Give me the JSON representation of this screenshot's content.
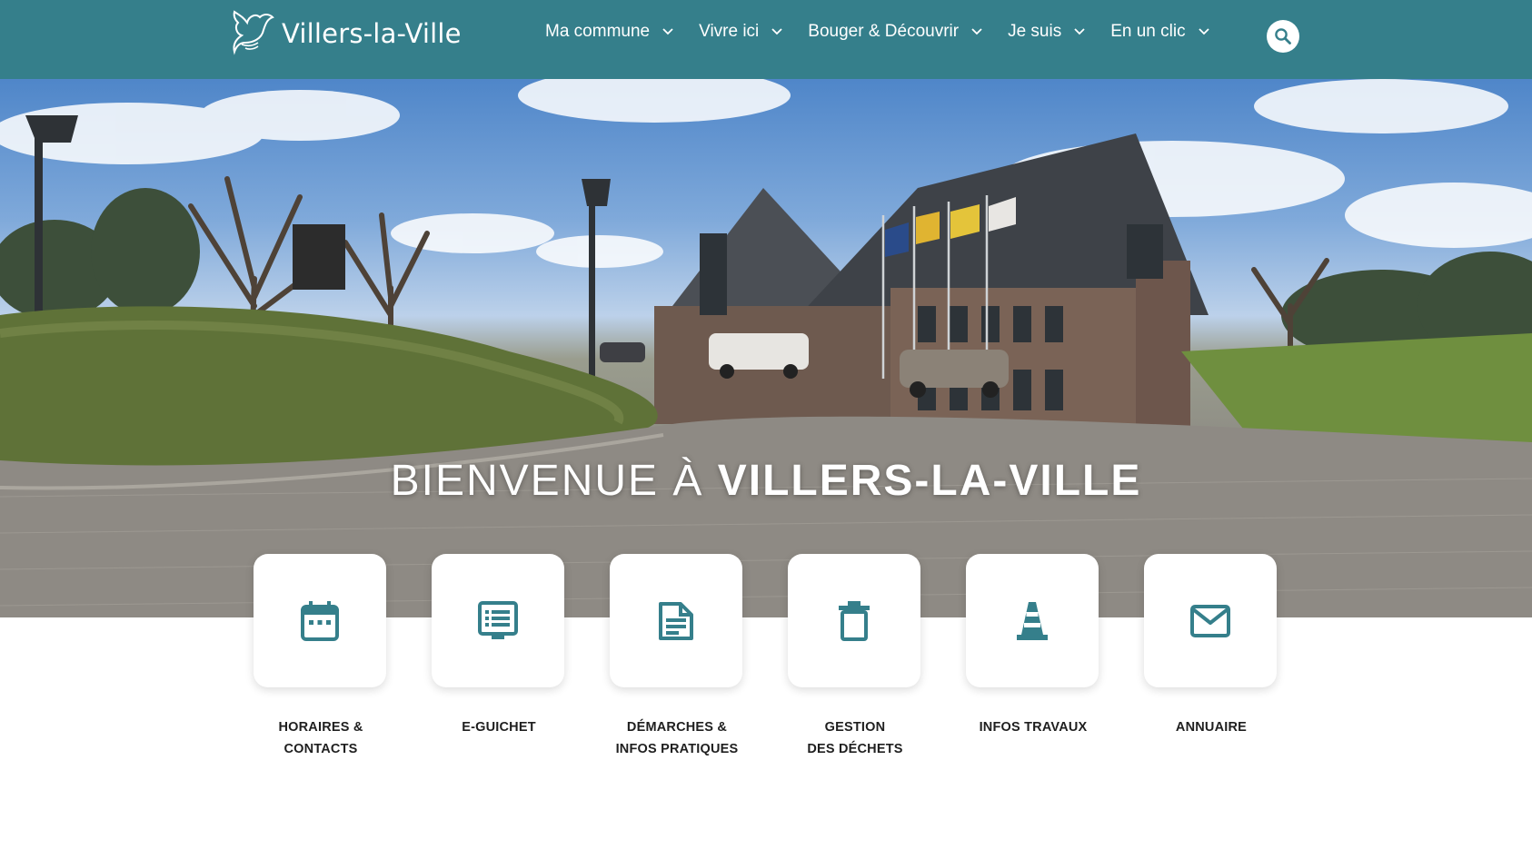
{
  "brand": {
    "name": "Villers-la-Ville"
  },
  "nav": {
    "items": [
      {
        "label": "Ma commune"
      },
      {
        "label": "Vivre ici"
      },
      {
        "label": "Bouger & Découvrir"
      },
      {
        "label": "Je suis"
      },
      {
        "label": "En un clic"
      }
    ],
    "search_icon": "search-icon"
  },
  "hero": {
    "title_light": "BIENVENUE À ",
    "title_bold": "VILLERS-LA-VILLE"
  },
  "quick_links": [
    {
      "label": "HORAIRES &\nCONTACTS",
      "icon": "calendar-icon"
    },
    {
      "label": "E-GUICHET",
      "icon": "list-document-icon"
    },
    {
      "label": "DÉMARCHES &\nINFOS PRATIQUES",
      "icon": "document-icon"
    },
    {
      "label": "GESTION\nDES DÉCHETS",
      "icon": "trash-icon"
    },
    {
      "label": "INFOS TRAVAUX",
      "icon": "traffic-cone-icon"
    },
    {
      "label": "ANNUAIRE",
      "icon": "mail-icon"
    }
  ],
  "colors": {
    "brand_teal": "#357f8b",
    "icon_teal": "#357f8b",
    "background": "#ffffff"
  }
}
